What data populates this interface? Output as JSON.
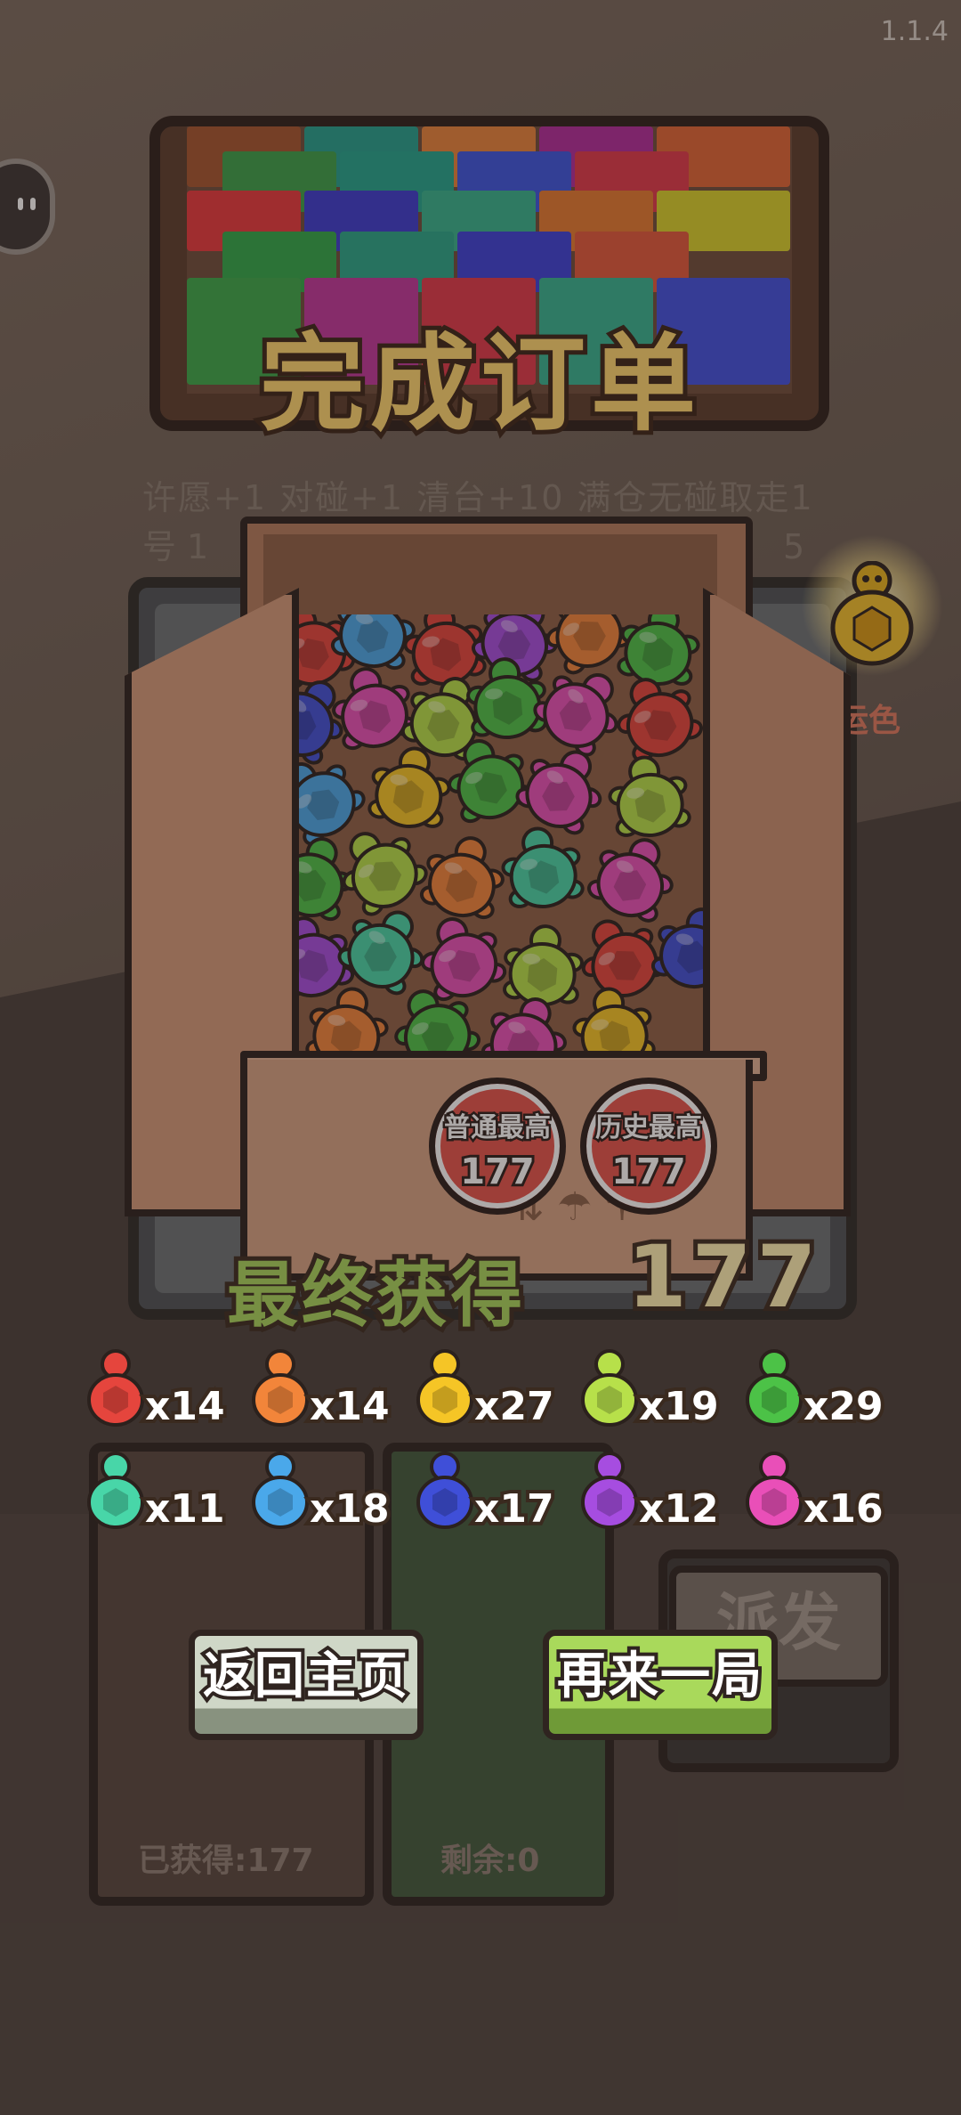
{
  "version": "1.1.4",
  "order_title": "完成订单",
  "hint_line1": "许愿+1 对碰+1 清台+10 满仓无碰取走1号",
  "hint_line2_left": "1",
  "hint_line2_right": "5",
  "lucky_color_label": "运色",
  "badges": {
    "normal_high": {
      "label": "普通最高",
      "value": "177"
    },
    "history_high": {
      "label": "历史最高",
      "value": "177"
    }
  },
  "final": {
    "label": "最终获得",
    "value": "177"
  },
  "counts": [
    {
      "color": "#e5453d",
      "text": "x14"
    },
    {
      "color": "#f2853a",
      "text": "x14"
    },
    {
      "color": "#f5c526",
      "text": "x27"
    },
    {
      "color": "#b7e04a",
      "text": "x19"
    },
    {
      "color": "#4cc247",
      "text": "x29"
    },
    {
      "color": "#48d6a8",
      "text": "x11"
    },
    {
      "color": "#4aa8ea",
      "text": "x18"
    },
    {
      "color": "#3f4fd8",
      "text": "x17"
    },
    {
      "color": "#a64de0",
      "text": "x12"
    },
    {
      "color": "#e94fb8",
      "text": "x16"
    }
  ],
  "bins": {
    "obtained": "已获得:177",
    "remaining": "剩余:0"
  },
  "send_label": "派发",
  "buttons": {
    "home": "返回主页",
    "again": "再来一局"
  }
}
